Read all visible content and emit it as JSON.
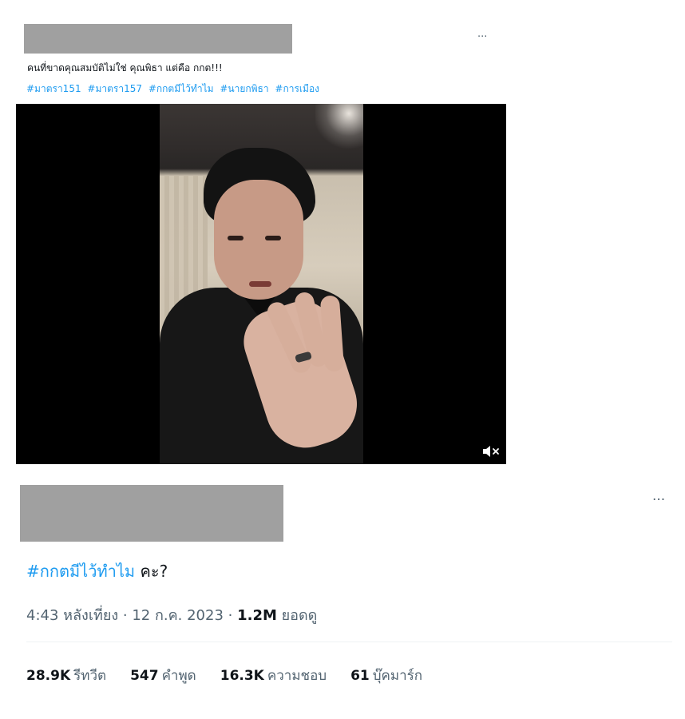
{
  "embed": {
    "more_label": "···",
    "text": "คนที่ขาดคุณสมบัติไม่ใช่ คุณพิธา แต่คือ กกต!!!",
    "hashtags": [
      "#มาตรา151",
      "#มาตรา157",
      "#กกตมีไว้ทำไม",
      "#นายกพิธา",
      "#การเมือง"
    ],
    "video": {
      "muted": true,
      "mute_icon": "speaker-muted-icon"
    }
  },
  "tweet": {
    "more_label": "···",
    "text": {
      "hashtag": "#กกตมีไว้ทำไม",
      "rest": " คะ?"
    },
    "meta": {
      "time": "4:43 หลังเที่ยง",
      "sep1": " · ",
      "date": "12 ก.ค. 2023",
      "sep2": " · ",
      "views": "1.2M",
      "views_label": " ยอดดู"
    },
    "stats": [
      {
        "num": "28.9K",
        "label": "รีทวีต"
      },
      {
        "num": "547",
        "label": "คำพูด"
      },
      {
        "num": "16.3K",
        "label": "ความชอบ"
      },
      {
        "num": "61",
        "label": "บุ๊คมาร์ก"
      }
    ]
  },
  "colors": {
    "accent": "#1d9bf0",
    "muted_text": "#536471",
    "redaction": "#a0a0a0"
  }
}
